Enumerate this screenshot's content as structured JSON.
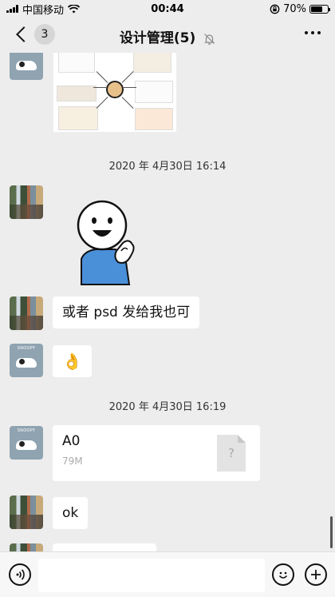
{
  "status_bar": {
    "carrier": "中国移动",
    "time": "00:44",
    "battery": "70%",
    "battery_level": 0.7
  },
  "nav": {
    "unread_count": "3",
    "title": "设计管理(5)"
  },
  "messages": {
    "timestamp_1": "2020 年 4月30日 16:14",
    "text_1": "或者 psd 发给我也可",
    "emoji_1": "👌",
    "timestamp_2": "2020 年 4月30日 16:19",
    "file": {
      "name": "A0",
      "size": "79M",
      "icon_text": "?"
    },
    "text_2": "ok"
  },
  "input": {
    "value": "",
    "placeholder": ""
  },
  "colors": {
    "background": "#ededed",
    "bubble": "#ffffff",
    "accent": "#111111"
  }
}
